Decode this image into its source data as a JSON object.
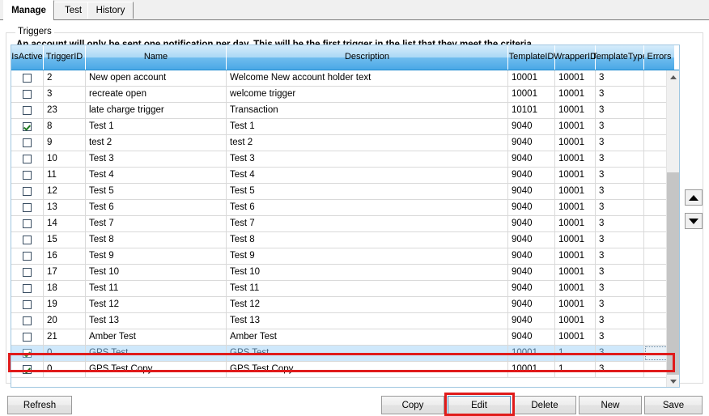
{
  "tabs": [
    {
      "label": "Manage",
      "active": true
    },
    {
      "label": "Test",
      "active": false
    },
    {
      "label": "History",
      "active": false
    }
  ],
  "group": {
    "legend": "Triggers",
    "note": "An account will only be sent one notification per day.   This will be the first trigger in the list that they meet the criteria."
  },
  "grid": {
    "columns": [
      {
        "key": "is_active",
        "label": "Is\nActive"
      },
      {
        "key": "trigger_id",
        "label": "Trigger\nID"
      },
      {
        "key": "name",
        "label": "Name"
      },
      {
        "key": "description",
        "label": "Description"
      },
      {
        "key": "template_id",
        "label": "Template\nID"
      },
      {
        "key": "wrapper_id",
        "label": "Wrapper\nID"
      },
      {
        "key": "template_type",
        "label": "Template\nType"
      },
      {
        "key": "errors",
        "label": "Errors"
      },
      {
        "key": "spacer",
        "label": ""
      }
    ],
    "rows": [
      {
        "is_active": false,
        "trigger_id": "2",
        "name": "New open account",
        "description": "Welcome New account holder text",
        "template_id": "10001",
        "wrapper_id": "10001",
        "template_type": "3",
        "errors": "",
        "selected": false
      },
      {
        "is_active": false,
        "trigger_id": "3",
        "name": "recreate open",
        "description": "welcome trigger",
        "template_id": "10001",
        "wrapper_id": "10001",
        "template_type": "3",
        "errors": "",
        "selected": false
      },
      {
        "is_active": false,
        "trigger_id": "23",
        "name": "late charge trigger",
        "description": "Transaction",
        "template_id": "10101",
        "wrapper_id": "10001",
        "template_type": "3",
        "errors": "",
        "selected": false
      },
      {
        "is_active": true,
        "trigger_id": "8",
        "name": "Test 1",
        "description": "Test 1",
        "template_id": "9040",
        "wrapper_id": "10001",
        "template_type": "3",
        "errors": "",
        "selected": false
      },
      {
        "is_active": false,
        "trigger_id": "9",
        "name": "test 2",
        "description": "test 2",
        "template_id": "9040",
        "wrapper_id": "10001",
        "template_type": "3",
        "errors": "",
        "selected": false
      },
      {
        "is_active": false,
        "trigger_id": "10",
        "name": "Test 3",
        "description": "Test 3",
        "template_id": "9040",
        "wrapper_id": "10001",
        "template_type": "3",
        "errors": "",
        "selected": false
      },
      {
        "is_active": false,
        "trigger_id": "11",
        "name": "Test 4",
        "description": "Test 4",
        "template_id": "9040",
        "wrapper_id": "10001",
        "template_type": "3",
        "errors": "",
        "selected": false
      },
      {
        "is_active": false,
        "trigger_id": "12",
        "name": "Test 5",
        "description": "Test 5",
        "template_id": "9040",
        "wrapper_id": "10001",
        "template_type": "3",
        "errors": "",
        "selected": false
      },
      {
        "is_active": false,
        "trigger_id": "13",
        "name": "Test 6",
        "description": "Test 6",
        "template_id": "9040",
        "wrapper_id": "10001",
        "template_type": "3",
        "errors": "",
        "selected": false
      },
      {
        "is_active": false,
        "trigger_id": "14",
        "name": "Test 7",
        "description": "Test 7",
        "template_id": "9040",
        "wrapper_id": "10001",
        "template_type": "3",
        "errors": "",
        "selected": false
      },
      {
        "is_active": false,
        "trigger_id": "15",
        "name": "Test 8",
        "description": "Test 8",
        "template_id": "9040",
        "wrapper_id": "10001",
        "template_type": "3",
        "errors": "",
        "selected": false
      },
      {
        "is_active": false,
        "trigger_id": "16",
        "name": "Test 9",
        "description": "Test 9",
        "template_id": "9040",
        "wrapper_id": "10001",
        "template_type": "3",
        "errors": "",
        "selected": false
      },
      {
        "is_active": false,
        "trigger_id": "17",
        "name": "Test 10",
        "description": "Test 10",
        "template_id": "9040",
        "wrapper_id": "10001",
        "template_type": "3",
        "errors": "",
        "selected": false
      },
      {
        "is_active": false,
        "trigger_id": "18",
        "name": "Test 11",
        "description": "Test 11",
        "template_id": "9040",
        "wrapper_id": "10001",
        "template_type": "3",
        "errors": "",
        "selected": false
      },
      {
        "is_active": false,
        "trigger_id": "19",
        "name": "Test 12",
        "description": "Test 12",
        "template_id": "9040",
        "wrapper_id": "10001",
        "template_type": "3",
        "errors": "",
        "selected": false
      },
      {
        "is_active": false,
        "trigger_id": "20",
        "name": "Test 13",
        "description": "Test 13",
        "template_id": "9040",
        "wrapper_id": "10001",
        "template_type": "3",
        "errors": "",
        "selected": false
      },
      {
        "is_active": false,
        "trigger_id": "21",
        "name": "Amber Test",
        "description": "Amber Test",
        "template_id": "9040",
        "wrapper_id": "10001",
        "template_type": "3",
        "errors": "",
        "selected": false
      },
      {
        "is_active": true,
        "trigger_id": "0",
        "name": "GPS Test",
        "description": "GPS Test",
        "template_id": "10001",
        "wrapper_id": "1",
        "template_type": "3",
        "errors": "",
        "selected": true
      },
      {
        "is_active": true,
        "trigger_id": "0",
        "name": "GPS Test Copy",
        "description": "GPS Test Copy",
        "template_id": "10001",
        "wrapper_id": "1",
        "template_type": "3",
        "errors": "",
        "selected": false
      }
    ]
  },
  "order_buttons": {
    "move_up": "move-up",
    "move_down": "move-down"
  },
  "scrollbar": {
    "up": "scroll-up",
    "down": "scroll-down"
  },
  "buttons": {
    "refresh": "Refresh",
    "copy": "Copy",
    "edit": "Edit",
    "delete": "Delete",
    "new": "New",
    "save": "Save"
  },
  "annotations": {
    "color": "#e01b1b",
    "targets": [
      "selected-row",
      "edit-button"
    ]
  }
}
